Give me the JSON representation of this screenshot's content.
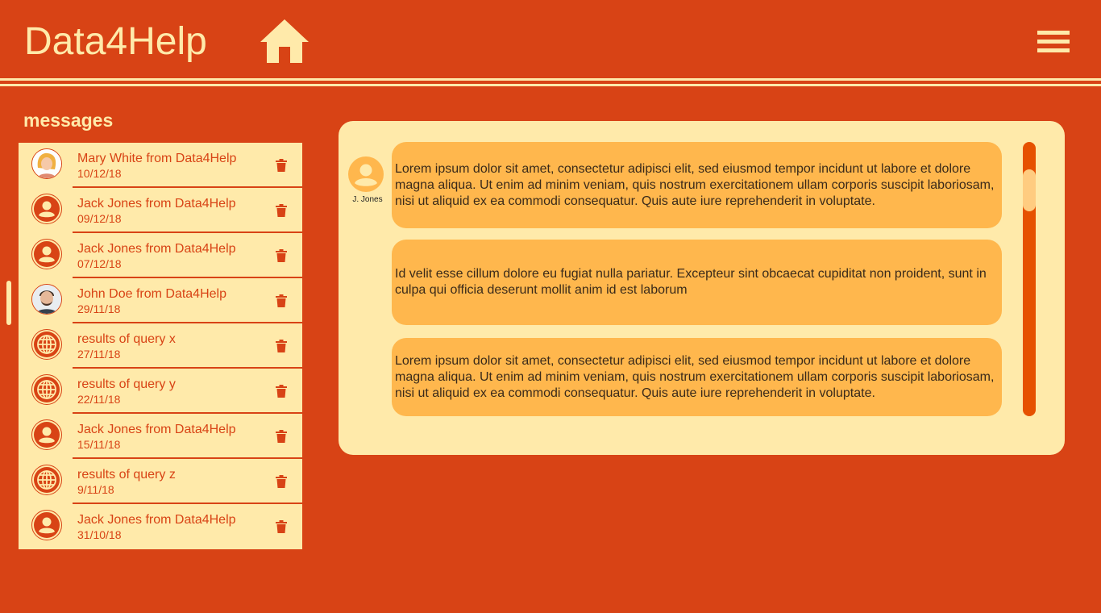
{
  "header": {
    "app_title": "Data4Help",
    "home_icon": "home-icon",
    "menu_icon": "hamburger-menu-icon"
  },
  "colors": {
    "background": "#d84315",
    "accent": "#ffeaaa",
    "bubble": "#ffb74d",
    "scrollbar": "#e65100"
  },
  "messages": {
    "title": "messages",
    "items": [
      {
        "title": "Mary White from Data4Help",
        "date": "10/12/18",
        "avatar": "photo-female"
      },
      {
        "title": "Jack Jones from Data4Help",
        "date": "09/12/18",
        "avatar": "person-icon"
      },
      {
        "title": "Jack Jones from Data4Help",
        "date": "07/12/18",
        "avatar": "person-icon"
      },
      {
        "title": "John Doe from Data4Help",
        "date": "29/11/18",
        "avatar": "photo-male"
      },
      {
        "title": "results of query x",
        "date": "27/11/18",
        "avatar": "globe-icon"
      },
      {
        "title": "results of query y",
        "date": "22/11/18",
        "avatar": "globe-icon"
      },
      {
        "title": "Jack Jones from Data4Help",
        "date": "15/11/18",
        "avatar": "person-icon"
      },
      {
        "title": "results of query z",
        "date": "9/11/18",
        "avatar": "globe-icon"
      },
      {
        "title": "Jack Jones from Data4Help",
        "date": "31/10/18",
        "avatar": "person-icon"
      }
    ]
  },
  "chat": {
    "sender_name": "J. Jones",
    "bubbles": [
      {
        "text": "Lorem ipsum dolor sit amet, consectetur adipisci elit, sed eiusmod tempor incidunt ut labore et dolore magna  aliqua. Ut enim ad minim veniam, quis nostrum exercitationem ullam corporis suscipit laboriosam, nisi ut aliquid  ex ea commodi consequatur. Quis aute iure reprehenderit in voluptate."
      },
      {
        "text": "Id velit esse cillum dolore eu fugiat nulla pariatur. Excepteur sint obcaecat cupiditat non proident, sunt in culpa  qui officia deserunt mollit anim id est laborum"
      },
      {
        "text": "Lorem ipsum dolor sit amet, consectetur adipisci elit, sed eiusmod tempor incidunt ut labore et dolore magna aliqua. Ut enim ad minim veniam, quis nostrum exercitationem ullam corporis suscipit laboriosam, nisi ut  aliquid ex ea commodi consequatur. Quis aute iure reprehenderit in voluptate."
      }
    ]
  }
}
